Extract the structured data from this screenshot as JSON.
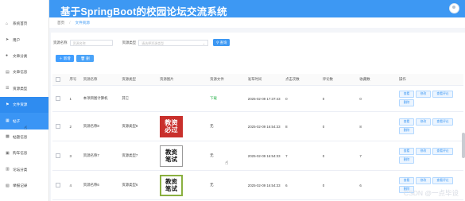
{
  "header": {
    "title": "基于SpringBoot的校园论坛交流系统"
  },
  "breadcrumb": {
    "home": "首页",
    "sep": "/",
    "current": "文件资源"
  },
  "sidebar": {
    "items": [
      {
        "label": "系统首页",
        "icon": "home-icon"
      },
      {
        "label": "用户",
        "icon": "send-icon"
      },
      {
        "label": "文章分类",
        "icon": "user-icon"
      },
      {
        "label": "文章信息",
        "icon": "document-icon"
      },
      {
        "label": "资源类型",
        "icon": "list-icon"
      },
      {
        "label": "文件资源",
        "icon": "flag-icon"
      },
      {
        "label": "帖子",
        "icon": "folder-icon"
      },
      {
        "label": "帖题信息",
        "icon": "grid-icon"
      },
      {
        "label": "购车信息",
        "icon": "cart-icon"
      },
      {
        "label": "论坛分类",
        "icon": "tag-icon"
      },
      {
        "label": "举报记录",
        "icon": "report-icon"
      }
    ]
  },
  "search": {
    "name_label": "资源名称",
    "name_placeholder": "资源名称",
    "type_label": "资源类型",
    "type_placeholder": "请选择资源类型",
    "button": "查询"
  },
  "actions": {
    "add": "新增",
    "delete": "删除"
  },
  "table": {
    "headers": [
      "序号",
      "资源名称",
      "资源类型",
      "资源图片",
      "资源文件",
      "发布时间",
      "点击次数",
      "评论数",
      "收藏数",
      "操作"
    ],
    "rows": [
      {
        "index": "1",
        "name": "本项目图计算机",
        "type": "其它",
        "image": "",
        "file": "下载",
        "time": "2025-02-09 17:37:43",
        "clicks": "0",
        "comments": "0",
        "favorites": "0",
        "ops": [
          "查看",
          "修改",
          "查看评论",
          "删除"
        ]
      },
      {
        "index": "2",
        "name": "资源名称8",
        "type": "资源类型8",
        "image": "教资必过",
        "file": "无",
        "time": "2025-02-09 16:54:33",
        "clicks": "8",
        "comments": "0",
        "favorites": "8",
        "ops": [
          "查看",
          "修改",
          "查看评论",
          "删除"
        ]
      },
      {
        "index": "3",
        "name": "资源名称7",
        "type": "资源类型7",
        "image": "教资笔试",
        "file": "无",
        "time": "2025-02-09 16:54:33",
        "clicks": "7",
        "comments": "0",
        "favorites": "7",
        "ops": [
          "查看",
          "修改",
          "查看评论",
          "删除"
        ]
      },
      {
        "index": "4",
        "name": "资源名称6",
        "type": "资源类型6",
        "image": "教资笔试",
        "file": "无",
        "time": "2025-02-09 16:54:33",
        "clicks": "6",
        "comments": "0",
        "favorites": "6",
        "ops": [
          "查看",
          "修改",
          "查看评论",
          "删除"
        ]
      }
    ]
  },
  "watermark": "CSDN @一点毕设",
  "colors": {
    "primary": "#3d98f3",
    "active_menu": "#2f8cf0",
    "link_green": "#2bb24c"
  }
}
